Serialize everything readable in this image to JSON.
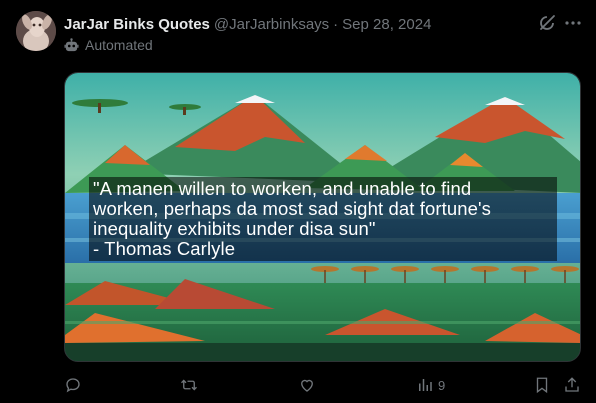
{
  "post": {
    "display_name": "JarJar Binks Quotes",
    "handle": "@JarJarbinksays",
    "separator": "·",
    "date": "Sep 28, 2024",
    "automated_label": "Automated",
    "image_text": "\"A manen willen to worken, and unable to find\nworken, perhaps da most sad sight dat fortune's\ninequality exhibits under disa sun\"\n- Thomas Carlyle"
  },
  "actions": {
    "views_count": "9"
  },
  "icons": {
    "header": [
      "grok-icon",
      "more-icon"
    ],
    "automated": "bot-icon",
    "action_bar": [
      "reply-icon",
      "repost-icon",
      "like-icon",
      "views-icon",
      "bookmark-icon",
      "share-icon"
    ]
  },
  "colors": {
    "background": "#000000",
    "primary_text": "#e7e9ea",
    "secondary_text": "#71767b",
    "border": "#2f3336"
  }
}
